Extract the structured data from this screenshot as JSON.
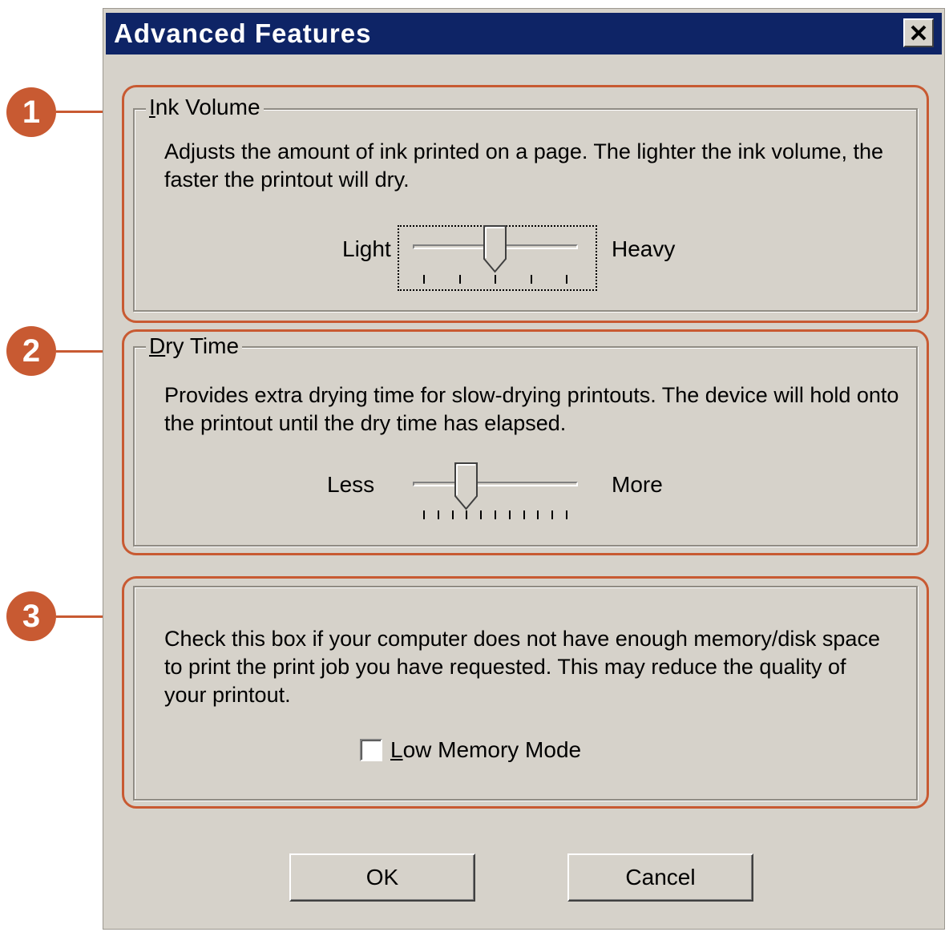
{
  "window": {
    "title": "Advanced Features"
  },
  "callouts": [
    "1",
    "2",
    "3"
  ],
  "ink_volume": {
    "group_label": "Ink Volume",
    "description": "Adjusts the amount of ink printed on a page. The lighter the ink volume, the faster the printout will dry.",
    "min_label": "Light",
    "max_label": "Heavy",
    "tick_count": 5,
    "value_index": 2
  },
  "dry_time": {
    "group_label": "Dry Time",
    "description": "Provides extra drying time for slow-drying printouts. The device will hold onto the printout until the dry time has elapsed.",
    "min_label": "Less",
    "max_label": "More",
    "tick_count": 11,
    "value_index": 3
  },
  "low_memory": {
    "description": "Check this box if your computer does not have enough memory/disk space to print the print job you have requested. This may reduce the quality of your printout.",
    "checkbox_label": "Low Memory Mode",
    "checked": false
  },
  "buttons": {
    "ok": "OK",
    "cancel": "Cancel"
  },
  "colors": {
    "callout": "#c85a32",
    "titlebar": "#0e2466",
    "dialog_bg": "#d6d2ca"
  }
}
